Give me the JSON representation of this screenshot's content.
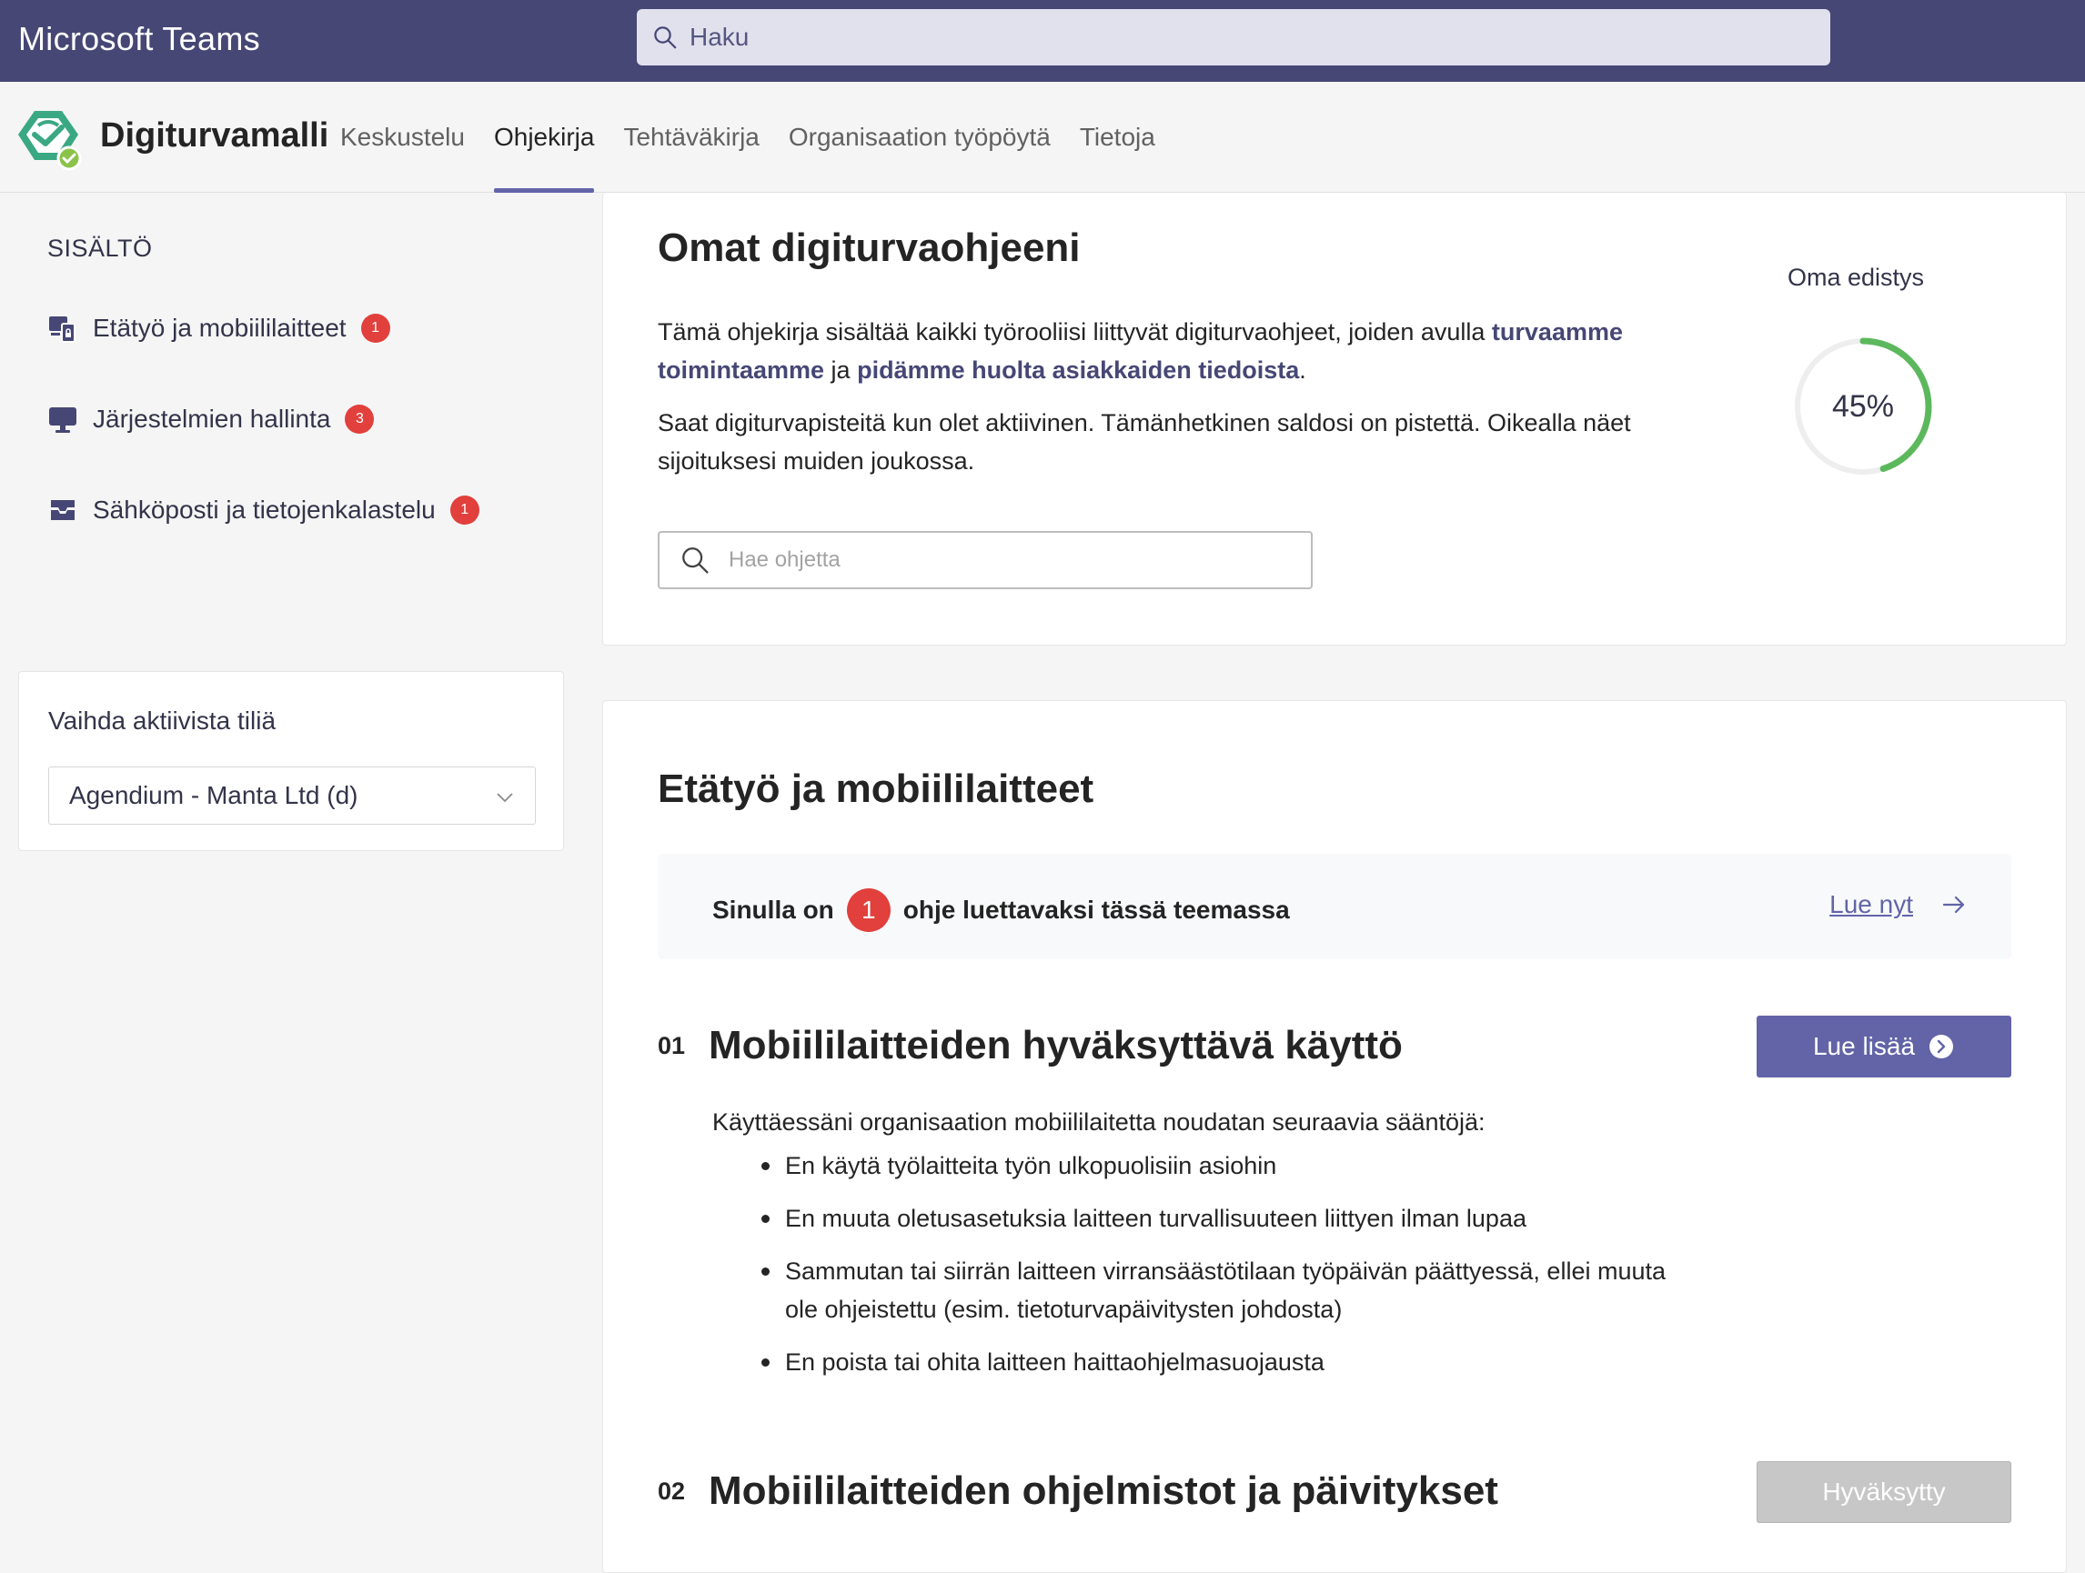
{
  "teams": {
    "title": "Microsoft Teams",
    "search_placeholder": "Haku"
  },
  "app": {
    "name": "Digiturvamalli",
    "tabs": [
      {
        "label": "Keskustelu",
        "active": false
      },
      {
        "label": "Ohjekirja",
        "active": true
      },
      {
        "label": "Tehtäväkirja",
        "active": false
      },
      {
        "label": "Organisaation työpöytä",
        "active": false
      },
      {
        "label": "Tietoja",
        "active": false
      }
    ]
  },
  "sidebar": {
    "heading": "SISÄLTÖ",
    "items": [
      {
        "label": "Etätyö ja mobiililaitteet",
        "badge": "1",
        "icon": "devices-lock-icon"
      },
      {
        "label": "Järjestelmien hallinta",
        "badge": "3",
        "icon": "monitor-icon"
      },
      {
        "label": "Sähköposti ja tietojenkalastelu",
        "badge": "1",
        "icon": "mail-inbox-icon"
      }
    ],
    "account": {
      "label": "Vaihda aktiivista tiliä",
      "selected": "Agendium - Manta Ltd (d)"
    }
  },
  "intro": {
    "title": "Omat digiturvaohjeeni",
    "p1_start": "Tämä ohjekirja sisältää kaikki työrooliisi liittyvät digiturvaohjeet, joiden avulla ",
    "p1_bold1": "turvaamme toimintaamme",
    "p1_mid": " ja ",
    "p1_bold2": "pidämme huolta asiakkaiden tiedoista",
    "p1_end": ".",
    "p2": "Saat digiturvapisteitä kun olet aktiivinen. Tämänhetkinen saldosi on pistettä. Oikealla näet sijoituksesi muiden joukossa.",
    "search_placeholder": "Hae ohjetta",
    "progress_label": "Oma edistys",
    "progress_value": 45,
    "progress_text": "45%"
  },
  "topic": {
    "title": "Etätyö ja mobiililaitteet",
    "notice_prefix": "Sinulla on",
    "notice_count": "1",
    "notice_suffix": "ohje luettavaksi tässä teemassa",
    "read_now": "Lue nyt",
    "guides": [
      {
        "num": "01",
        "title": "Mobiililaitteiden hyväksyttävä käyttö",
        "button": "Lue lisää",
        "intro": "Käyttäessäni organisaation mobiililaitetta noudatan seuraavia sääntöjä:",
        "rules": [
          "En käytä työlaitteita työn ulkopuolisiin asiohin",
          "En muuta oletusasetuksia laitteen turvallisuuteen liittyen ilman lupaa",
          "Sammutan tai siirrän laitteen virransäästötilaan työpäivän päättyessä, ellei muuta ole ohjeistettu (esim. tietoturvapäivitysten johdosta)",
          "En poista tai ohita laitteen haittaohjelmasuojausta"
        ]
      },
      {
        "num": "02",
        "title": "Mobiililaitteiden ohjelmistot ja päivitykset",
        "button": "Hyväksytty"
      }
    ]
  },
  "colors": {
    "teams_bar": "#464775",
    "accent": "#6264a7",
    "badge": "#e1403c",
    "progress": "#5cb85c"
  }
}
